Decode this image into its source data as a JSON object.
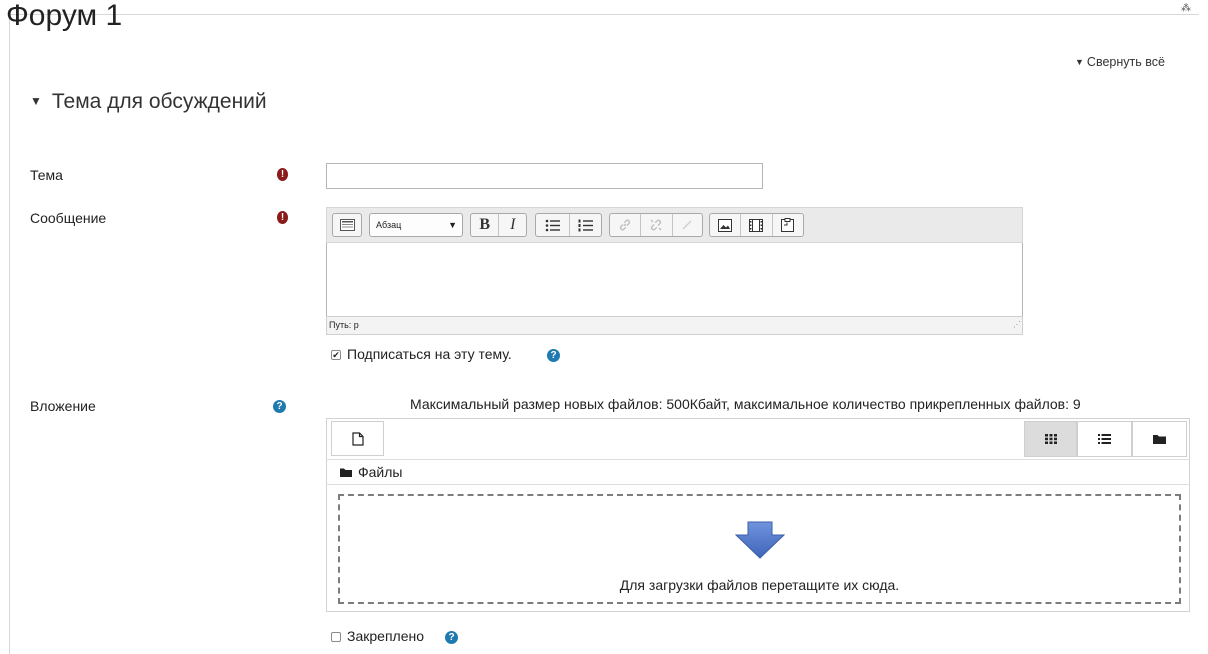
{
  "header": {
    "title": "Форум 1",
    "corner_mark": "⁂",
    "collapse_all": "Свернуть всё"
  },
  "section": {
    "title": "Тема для обсуждений"
  },
  "fields": {
    "subject": {
      "label": "Тема",
      "value": ""
    },
    "message": {
      "label": "Сообщение",
      "paragraph_format": "Абзац",
      "path": "Путь: р"
    },
    "subscribe": {
      "label": "Подписаться на эту тему.",
      "checked": true
    },
    "attachment": {
      "label": "Вложение",
      "limits": "Максимальный размер новых файлов: 500Кбайт, максимальное количество прикрепленных файлов: 9",
      "folder_label": "Файлы",
      "drop_hint": "Для загрузки файлов перетащите их сюда."
    },
    "pinned": {
      "label": "Закреплено",
      "checked": false
    }
  },
  "icons": {
    "required": "exclamation-icon",
    "help": "question-icon",
    "colors": {
      "required": "#8b1a1a",
      "help": "#1f7ab0",
      "drop_arrow": "#4a74c9"
    }
  }
}
